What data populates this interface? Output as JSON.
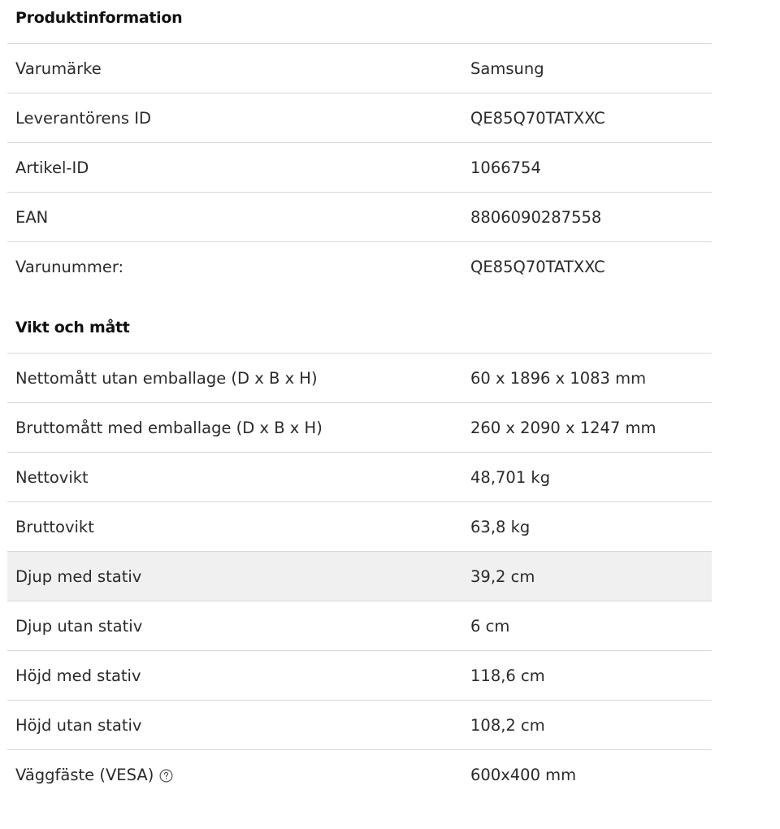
{
  "sections": [
    {
      "title": "Produktinformation",
      "rows": [
        {
          "label": "Varumärke",
          "value": "Samsung"
        },
        {
          "label": "Leverantörens ID",
          "value": "QE85Q70TATXXC"
        },
        {
          "label": "Artikel-ID",
          "value": "1066754"
        },
        {
          "label": "EAN",
          "value": "8806090287558"
        },
        {
          "label": "Varunummer:",
          "value": "QE85Q70TATXXC"
        }
      ]
    },
    {
      "title": "Vikt och mått",
      "rows": [
        {
          "label": "Nettomått utan emballage (D x B x H)",
          "value": "60 x 1896 x 1083 mm"
        },
        {
          "label": "Bruttomått med emballage (D x B x H)",
          "value": "260 x 2090 x 1247 mm"
        },
        {
          "label": "Nettovikt",
          "value": "48,701 kg"
        },
        {
          "label": "Bruttovikt",
          "value": "63,8 kg"
        },
        {
          "label": "Djup med stativ",
          "value": "39,2 cm"
        },
        {
          "label": "Djup utan stativ",
          "value": "6 cm"
        },
        {
          "label": "Höjd med stativ",
          "value": "118,6 cm"
        },
        {
          "label": "Höjd utan stativ",
          "value": "108,2 cm"
        },
        {
          "label": "Väggfäste (VESA)",
          "value": "600x400 mm",
          "icon": "help-circle-icon"
        }
      ]
    }
  ],
  "colors": {
    "divider": "#d8d8d8",
    "highlight_row": "#f0f0f0",
    "text": "#2a2a2a",
    "heading": "#111111"
  }
}
